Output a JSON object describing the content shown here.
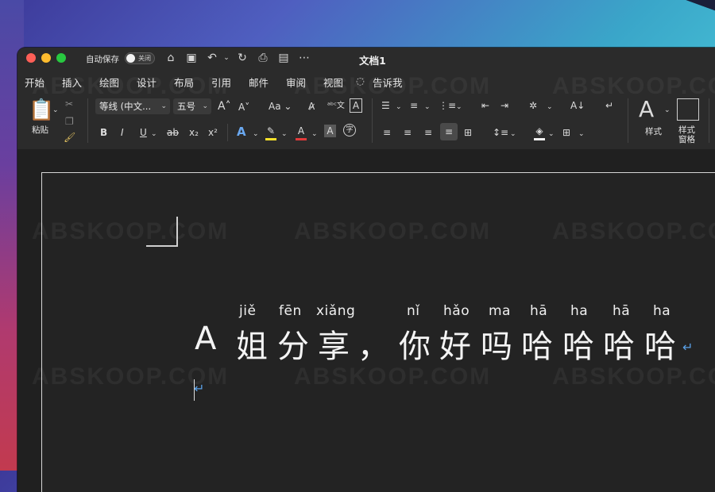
{
  "window": {
    "title": "文档1",
    "autosave_label": "自动保存",
    "autosave_toggle": "关闭"
  },
  "ribbon_tabs": [
    "开始",
    "插入",
    "绘图",
    "设计",
    "布局",
    "引用",
    "邮件",
    "审阅",
    "视图",
    "告诉我"
  ],
  "active_tab": "开始",
  "toolbar": {
    "paste_label": "粘贴",
    "font_name": "等线 (中文...",
    "font_size": "五号",
    "change_case": "Aa",
    "bold": "B",
    "italic": "I",
    "underline": "U",
    "strike": "ab",
    "subscript": "x₂",
    "superscript": "x²",
    "styles_label": "样式",
    "styles_pane_label_1": "样式",
    "styles_pane_label_2": "窗格"
  },
  "document": {
    "pinyin": [
      "jiě",
      "fēn",
      "xiǎng",
      "nǐ",
      "hǎo",
      "ma",
      "hā",
      "ha",
      "hā",
      "ha"
    ],
    "line_text": "A 姐分享，你好吗哈哈哈哈",
    "hanzi": [
      "A",
      "姐",
      "分",
      "享",
      "，",
      "你",
      "好",
      "吗",
      "哈",
      "哈",
      "哈",
      "哈"
    ],
    "paragraph_mark": "↵"
  },
  "watermark_text": "ABSKOOP.COM",
  "colors": {
    "accent_para_mark": "#5aa0e6",
    "highlight_yellow": "#f7e12b",
    "font_color_red": "#e03a3a"
  }
}
